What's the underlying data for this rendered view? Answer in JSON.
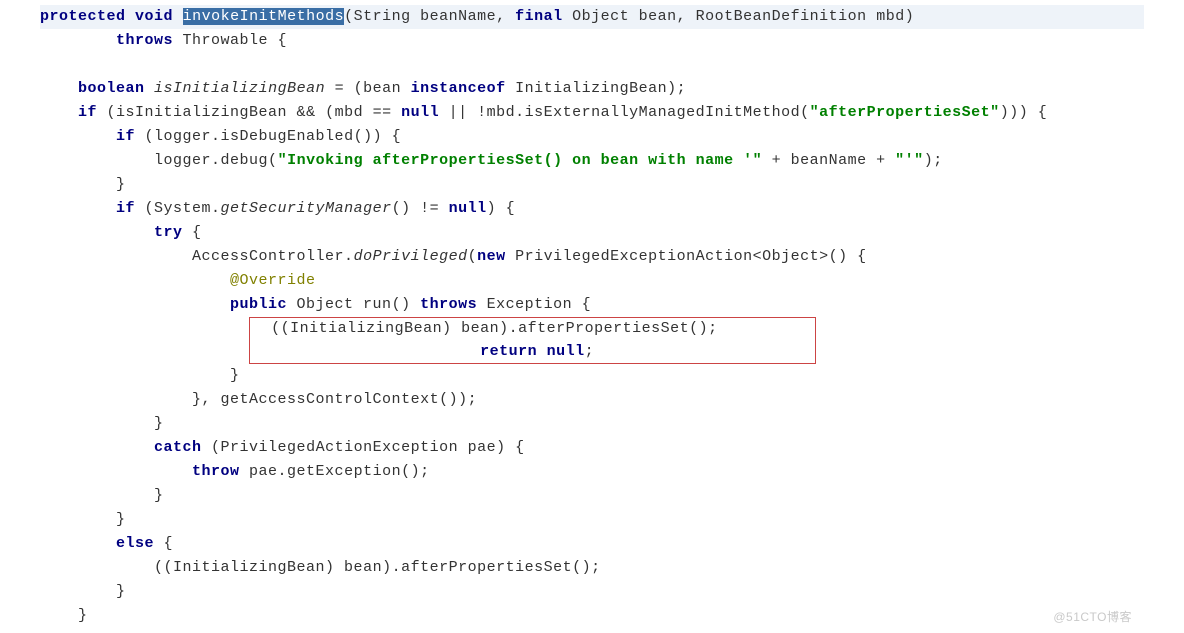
{
  "code": {
    "l1_kw1": "protected",
    "l1_kw2": "void",
    "l1_method": "invokeInitMethods",
    "l1_p1": "(String beanName, ",
    "l1_kw3": "final",
    "l1_p2": " Object bean, RootBeanDefinition mbd)",
    "l2_kw": "throws",
    "l2_rest": " Throwable {",
    "l3_kw": "boolean",
    "l3_var": "isInitializingBean",
    "l3_op": " = (bean ",
    "l3_kw2": "instanceof",
    "l3_rest": " InitializingBean);",
    "l4_kw": "if",
    "l4_a": " (isInitializingBean && (mbd == ",
    "l4_kw2": "null",
    "l4_b": " || !mbd.isExternallyManagedInitMethod(",
    "l4_str": "\"afterPropertiesSet\"",
    "l4_c": "))) {",
    "l5_kw": "if",
    "l5_a": " (logger.isDebugEnabled()) {",
    "l6_a": "logger.debug(",
    "l6_str1": "\"Invoking afterPropertiesSet() on bean with name '\"",
    "l6_b": " + beanName + ",
    "l6_str2": "\"'\"",
    "l6_c": ");",
    "l7": "}",
    "l8_kw": "if",
    "l8_a": " (System.",
    "l8_m": "getSecurityManager",
    "l8_b": "() != ",
    "l8_kw2": "null",
    "l8_c": ") {",
    "l9_kw": "try",
    "l9_a": " {",
    "l10_a": "AccessController.",
    "l10_m": "doPrivileged",
    "l10_b": "(",
    "l10_kw": "new",
    "l10_c": " PrivilegedExceptionAction<Object>() {",
    "l11": "@Override",
    "l12_kw": "public",
    "l12_a": " Object run() ",
    "l12_kw2": "throws",
    "l12_b": " Exception {",
    "l13_a": "((InitializingBean) bean).afterPropertiesSet();",
    "l13_spacer": "          ",
    "l14_kw": "return",
    "l14_a": " ",
    "l14_kw2": "null",
    "l14_b": ";",
    "l15": "}",
    "l16": "}, getAccessControlContext());",
    "l17": "}",
    "l18_kw": "catch",
    "l18_a": " (PrivilegedActionException pae) {",
    "l19_kw": "throw",
    "l19_a": " pae.getException();",
    "l20": "}",
    "l21": "}",
    "l22_kw": "else",
    "l22_a": " {",
    "l23": "((InitializingBean) bean).afterPropertiesSet();",
    "l24": "}",
    "l25": "}"
  },
  "watermark": "@51CTO博客"
}
